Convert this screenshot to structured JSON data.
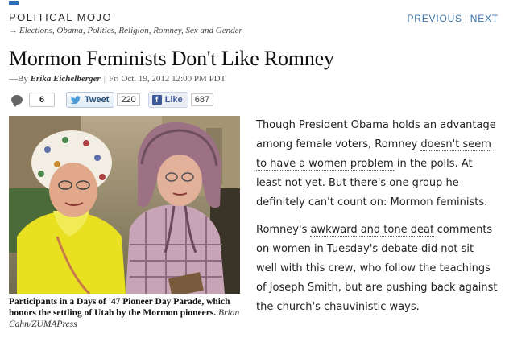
{
  "header": {
    "section_title": "POLITICAL MOJO",
    "nav_previous": "PREVIOUS",
    "nav_separator": "|",
    "nav_next": "NEXT",
    "tags_arrow": "→",
    "tags": "Elections, Obama, Politics, Religion, Romney, Sex and Gender",
    "accent_color": "#2d6db5"
  },
  "article": {
    "headline": "Mormon Feminists Don't Like Romney",
    "byline_prefix": "—By",
    "author": "Erika Eichelberger",
    "byline_separator": "|",
    "date": "Fri Oct. 19, 2012 12:00 PM PDT"
  },
  "social": {
    "comment_icon": "comment-bubble-icon",
    "comment_count": "6",
    "tweet_label": "Tweet",
    "tweet_count": "220",
    "like_label": "Like",
    "like_count": "687"
  },
  "photo": {
    "caption": "Participants in a Days of '47 Pioneer Day Parade, which honors the settling of Utah by the Mormon pioneers.",
    "credit": "Brian Cahn/ZUMAPress"
  },
  "body": {
    "p1_a": "Though President Obama holds an advantage among female voters, Romney ",
    "p1_link": "doesn't seem to have a women problem",
    "p1_b": " in the polls. At least not yet. But there's one group he definitely can't count on: Mormon feminists.",
    "p2_a": "Romney's ",
    "p2_link": "awkward and tone deaf",
    "p2_b": " comments on women in Tuesday's debate did not sit well with this crew, who follow the teachings of Joseph Smith, but are pushing back against the church's chauvinistic ways."
  }
}
